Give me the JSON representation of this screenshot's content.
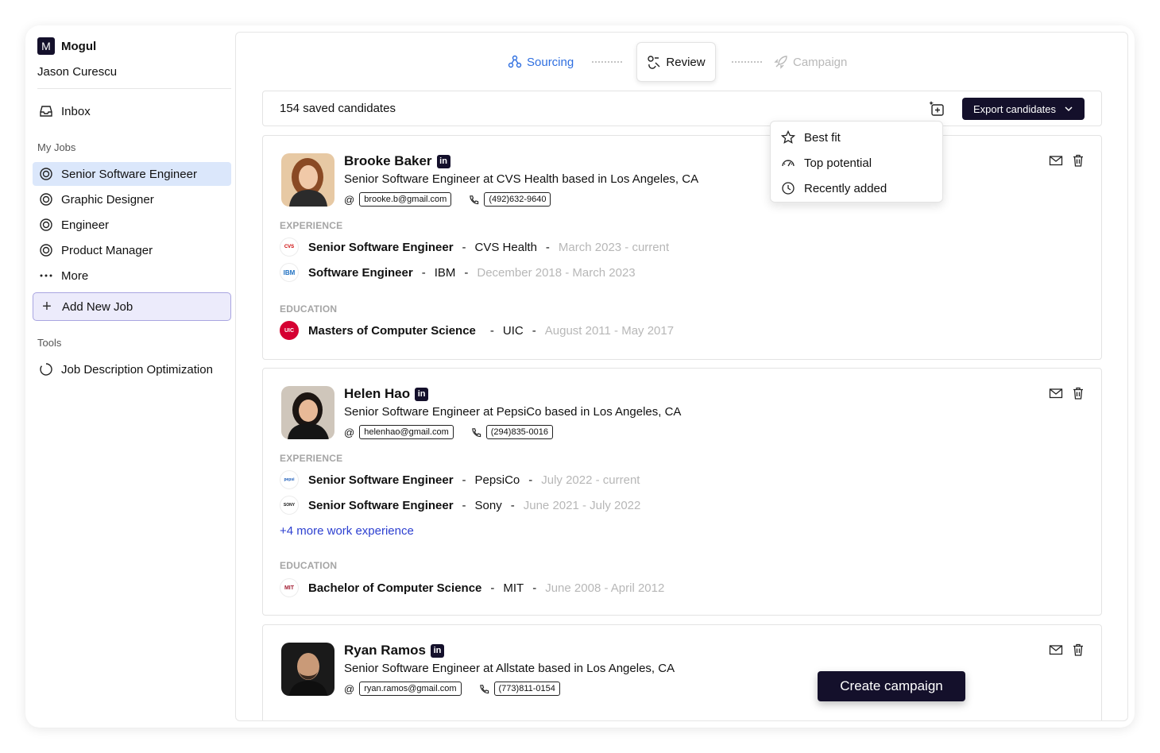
{
  "brand": {
    "logo_letter": "M",
    "name": "Mogul"
  },
  "user": {
    "name": "Jason Curescu"
  },
  "sidebar": {
    "inbox_label": "Inbox",
    "my_jobs_heading": "My Jobs",
    "jobs": [
      {
        "label": "Senior Software Engineer",
        "active": true
      },
      {
        "label": "Graphic Designer",
        "active": false
      },
      {
        "label": "Engineer",
        "active": false
      },
      {
        "label": "Product Manager",
        "active": false
      }
    ],
    "more_label": "More",
    "add_job_label": "Add New Job",
    "tools_heading": "Tools",
    "tools": [
      {
        "label": "Job Description Optimization"
      }
    ]
  },
  "steps": [
    {
      "label": "Sourcing",
      "state": "done"
    },
    {
      "label": "Review",
      "state": "current"
    },
    {
      "label": "Campaign",
      "state": "upcoming"
    }
  ],
  "toolbar": {
    "saved_count_text": "154 saved candidates",
    "export_label": "Export candidates"
  },
  "sort_menu": {
    "items": [
      {
        "label": "Best fit",
        "icon": "star-icon"
      },
      {
        "label": "Top potential",
        "icon": "gauge-icon"
      },
      {
        "label": "Recently added",
        "icon": "clock-icon"
      }
    ]
  },
  "labels": {
    "experience": "EXPERIENCE",
    "education": "EDUCATION",
    "linkedin": "in"
  },
  "candidates": [
    {
      "name": "Brooke Baker",
      "headline": "Senior Software Engineer at CVS Health based in Los Angeles, CA",
      "email": "brooke.b@gmail.com",
      "phone": "(492)632-9640",
      "experience": [
        {
          "role": "Senior Software Engineer",
          "company": "CVS Health",
          "dates": "March 2023 - current",
          "logo_text": "CVS"
        },
        {
          "role": "Software Engineer",
          "company": "IBM",
          "dates": "December 2018 - March 2023",
          "logo_text": "IBM"
        }
      ],
      "more_experience": "",
      "education": [
        {
          "degree": "Masters of Computer Science",
          "school": "UIC",
          "dates": "August 2011 - May 2017",
          "logo_text": "UIC"
        }
      ]
    },
    {
      "name": "Helen Hao",
      "headline": "Senior Software Engineer at PepsiCo based in Los Angeles, CA",
      "email": "helenhao@gmail.com",
      "phone": "(294)835-0016",
      "experience": [
        {
          "role": "Senior Software Engineer",
          "company": "PepsiCo",
          "dates": "July 2022 - current",
          "logo_text": "pepsi"
        },
        {
          "role": "Senior Software Engineer",
          "company": "Sony",
          "dates": "June 2021 - July 2022",
          "logo_text": "SONY"
        }
      ],
      "more_experience": "+4 more work experience",
      "education": [
        {
          "degree": "Bachelor of Computer Science",
          "school": "MIT",
          "dates": "June 2008 - April 2012",
          "logo_text": "MIT"
        }
      ]
    },
    {
      "name": "Ryan Ramos",
      "headline": "Senior Software Engineer at Allstate based in Los Angeles, CA",
      "email": "ryan.ramos@gmail.com",
      "phone": "(773)811-0154"
    }
  ],
  "toast": {
    "label": "Create campaign"
  },
  "colors": {
    "brand_dark": "#14102b",
    "accent_blue": "#2f6fe0",
    "active_bg": "#dbe7fb",
    "link": "#2c3fd0"
  }
}
